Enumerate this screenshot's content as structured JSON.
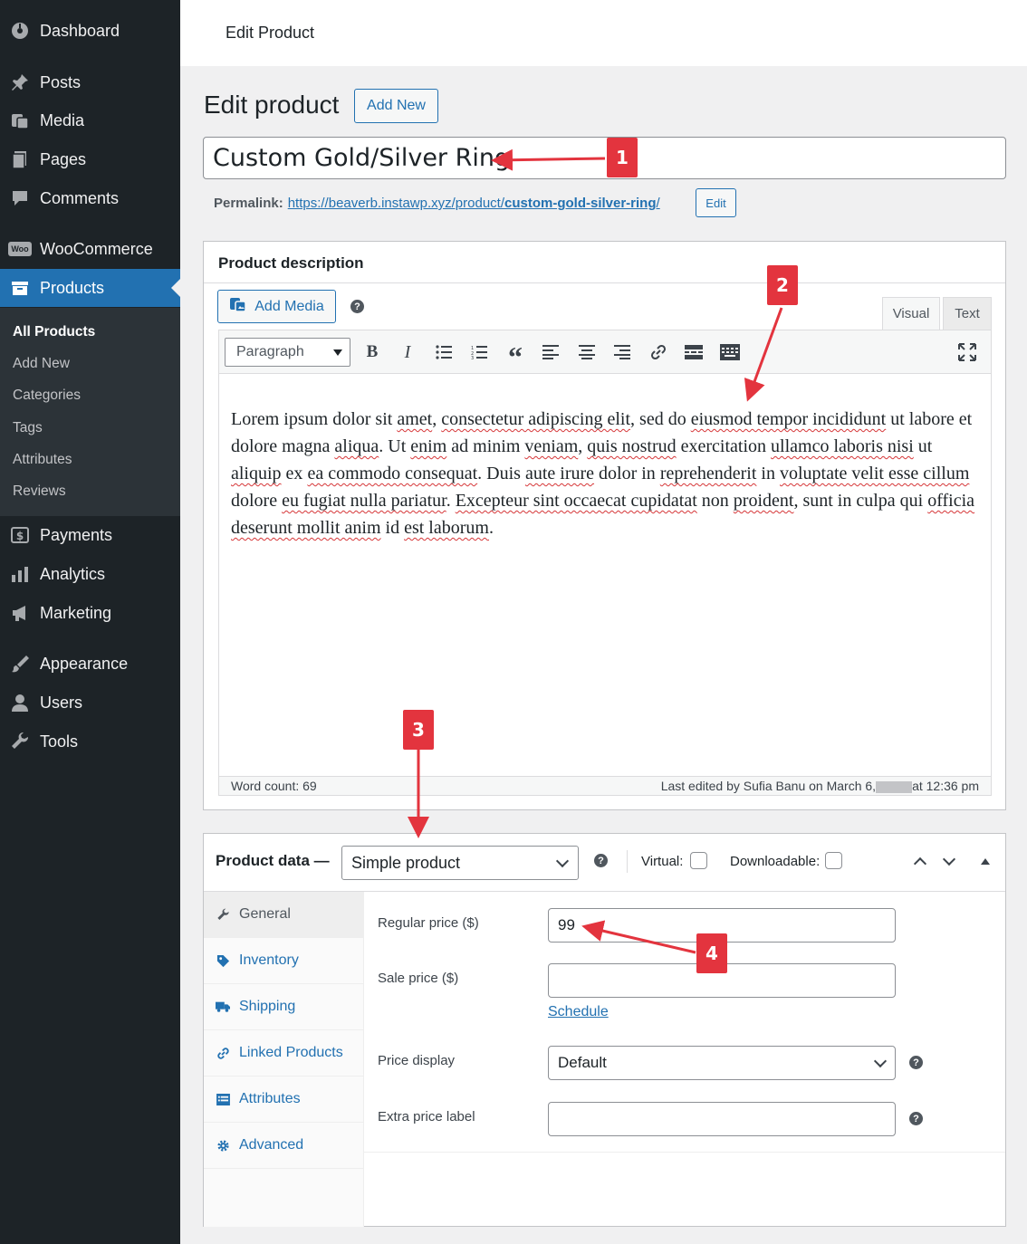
{
  "sidebar": {
    "menu": [
      {
        "label": "Dashboard",
        "icon": "dashboard-icon"
      },
      {
        "label": "Posts",
        "icon": "pin-icon"
      },
      {
        "label": "Media",
        "icon": "media-icon"
      },
      {
        "label": "Pages",
        "icon": "pages-icon"
      },
      {
        "label": "Comments",
        "icon": "comments-icon"
      },
      {
        "label": "WooCommerce",
        "icon": "woo-icon"
      },
      {
        "label": "Products",
        "icon": "archive-icon"
      },
      {
        "label": "Payments",
        "icon": "dollar-icon"
      },
      {
        "label": "Analytics",
        "icon": "chart-bar-icon"
      },
      {
        "label": "Marketing",
        "icon": "megaphone-icon"
      },
      {
        "label": "Appearance",
        "icon": "brush-icon"
      },
      {
        "label": "Users",
        "icon": "user-icon"
      },
      {
        "label": "Tools",
        "icon": "wrench-icon"
      }
    ],
    "submenu": [
      "All Products",
      "Add New",
      "Categories",
      "Tags",
      "Attributes",
      "Reviews"
    ],
    "woo_badge": "Woo"
  },
  "topbar": {
    "title": "Edit Product"
  },
  "page": {
    "title": "Edit product",
    "add_new": "Add New",
    "product_title": "Custom Gold/Silver Ring",
    "permalink_label": "Permalink:",
    "permalink_base": "https://beaverb.instawp.xyz/product/",
    "permalink_slug": "custom-gold-silver-ring",
    "permalink_end": "/",
    "permalink_edit": "Edit"
  },
  "description": {
    "title": "Product description",
    "add_media": "Add Media",
    "help": "?",
    "tabs": [
      "Visual",
      "Text"
    ],
    "format": "Paragraph",
    "word_count": "Word count: 69",
    "last_edited_before": "Last edited by Sufia Banu on March 6,",
    "last_edited_after": "at 12:36 pm"
  },
  "product_data": {
    "label": "Product data —",
    "type": "Simple product",
    "help": "?",
    "virtual_label": "Virtual:",
    "downloadable_label": "Downloadable:",
    "tabs": [
      {
        "label": "General",
        "icon": "wrench-icon"
      },
      {
        "label": "Inventory",
        "icon": "tag-icon"
      },
      {
        "label": "Shipping",
        "icon": "truck-icon"
      },
      {
        "label": "Linked Products",
        "icon": "link-icon"
      },
      {
        "label": "Attributes",
        "icon": "list-icon"
      },
      {
        "label": "Advanced",
        "icon": "gear-icon"
      }
    ],
    "fields": {
      "regular_price_label": "Regular price ($)",
      "regular_price_value": "99",
      "sale_price_label": "Sale price ($)",
      "sale_price_value": "",
      "schedule": "Schedule",
      "price_display_label": "Price display",
      "price_display_value": "Default",
      "extra_label": "Extra price label",
      "extra_value": ""
    }
  },
  "callouts": [
    "1",
    "2",
    "3",
    "4"
  ],
  "colors": {
    "sidebar": "#1d2327",
    "accent": "#2271b1",
    "callout": "#e3343e"
  }
}
